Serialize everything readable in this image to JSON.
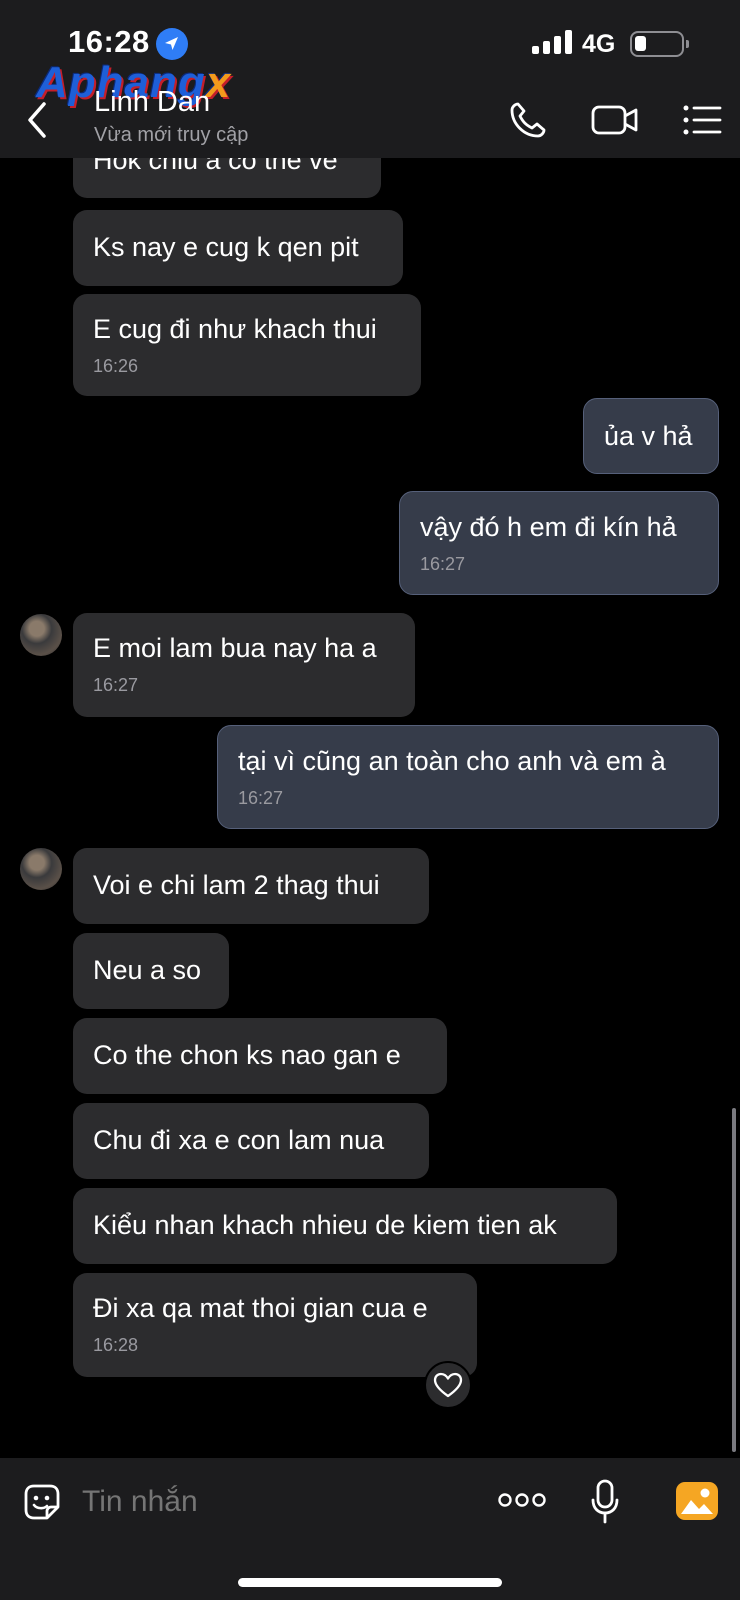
{
  "status_bar": {
    "time": "16:28",
    "network": "4G"
  },
  "watermark": {
    "main": "Aphang",
    "suffix": "x"
  },
  "header": {
    "contact_name": "Linh Dan",
    "contact_status": "Vừa mới truy cập"
  },
  "messages": [
    {
      "text": "Hok chiu a co the ve"
    },
    {
      "text": "Ks nay e cug k qen pit"
    },
    {
      "text": "E cug đi như khach thui",
      "time": "16:26"
    },
    {
      "text": "ủa v hả"
    },
    {
      "text": "vậy đó h em đi kín hả",
      "time": "16:27"
    },
    {
      "text": "E moi lam bua nay ha a",
      "time": "16:27"
    },
    {
      "text": "tại vì cũng an toàn cho anh và em à",
      "time": "16:27"
    },
    {
      "text": "Voi e chi lam 2 thag thui"
    },
    {
      "text": "Neu a so"
    },
    {
      "text": "Co the chon ks nao gan e"
    },
    {
      "text": "Chu đi xa e con lam nua"
    },
    {
      "text": "Kiểu nhan khach nhieu de kiem tien ak"
    },
    {
      "text": "Đi xa qa mat thoi gian cua e",
      "time": "16:28"
    }
  ],
  "input": {
    "placeholder": "Tin nhắn"
  },
  "icons": {
    "back": "chevron-left-icon",
    "call": "phone-icon",
    "video": "video-camera-icon",
    "menu": "list-menu-icon",
    "sticker": "sticker-smile-icon",
    "more": "more-dots-icon",
    "mic": "microphone-icon",
    "gallery": "image-gallery-icon",
    "reaction": "heart-icon",
    "location": "location-arrow-icon"
  },
  "colors": {
    "accent_blue": "#2f7df6",
    "gallery_orange": "#f5a623",
    "sent_bubble": "#363c4a",
    "received_bubble": "#2c2c2e"
  }
}
